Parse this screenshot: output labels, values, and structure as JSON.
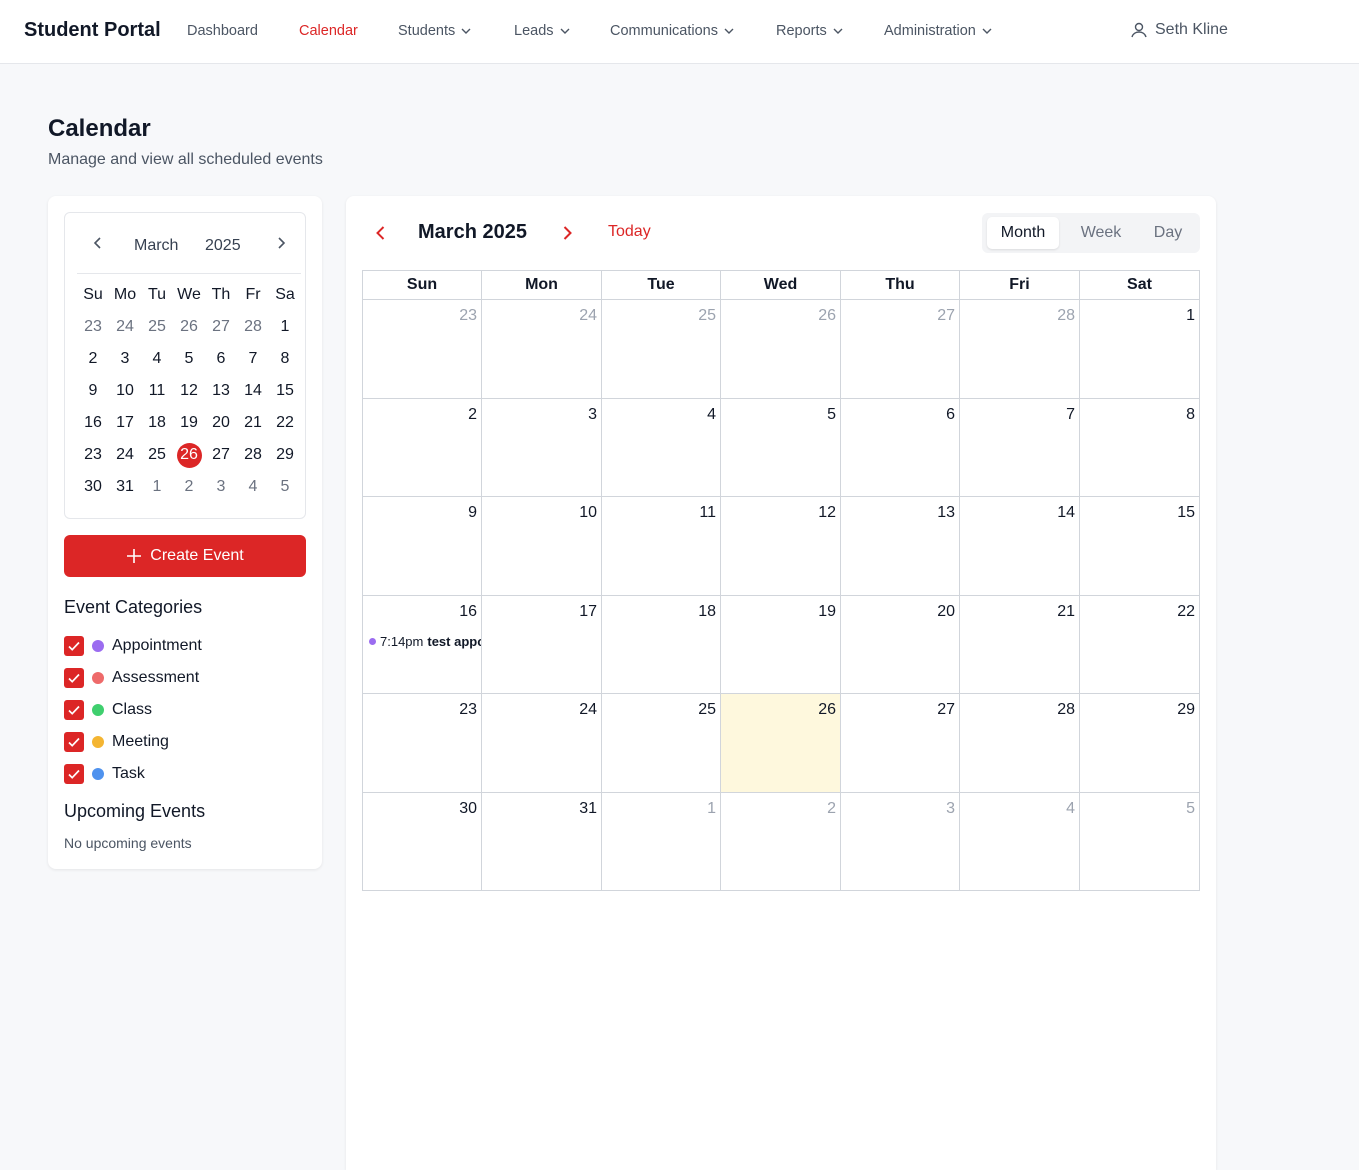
{
  "app": {
    "brand": "Student Portal",
    "nav": [
      "Dashboard",
      "Calendar",
      "Students",
      "Leads",
      "Communications",
      "Reports",
      "Administration"
    ],
    "user": "Seth Kline"
  },
  "page": {
    "title": "Calendar",
    "subtitle": "Manage and view all scheduled events"
  },
  "mini_calendar": {
    "month": "March",
    "year": "2025",
    "weekdays": [
      "Su",
      "Mo",
      "Tu",
      "We",
      "Th",
      "Fr",
      "Sa"
    ],
    "days": [
      "23",
      "24",
      "25",
      "26",
      "27",
      "28",
      "1",
      "2",
      "3",
      "4",
      "5",
      "6",
      "7",
      "8",
      "9",
      "10",
      "11",
      "12",
      "13",
      "14",
      "15",
      "16",
      "17",
      "18",
      "19",
      "20",
      "21",
      "22",
      "23",
      "24",
      "25",
      "26",
      "27",
      "28",
      "29",
      "30",
      "31",
      "1",
      "2",
      "3",
      "4",
      "5"
    ],
    "today": "26"
  },
  "create_event_label": "Create Event",
  "categories_title": "Event Categories",
  "categories": [
    {
      "label": "Appointment",
      "color": "#9b6cf0"
    },
    {
      "label": "Assessment",
      "color": "#ee6a6a"
    },
    {
      "label": "Class",
      "color": "#3fcf6e"
    },
    {
      "label": "Meeting",
      "color": "#f4b532"
    },
    {
      "label": "Task",
      "color": "#4f92ee"
    }
  ],
  "upcoming": {
    "title": "Upcoming Events",
    "empty": "No upcoming events"
  },
  "calendar": {
    "title": "March 2025",
    "today_label": "Today",
    "views": [
      "Month",
      "Week",
      "Day"
    ],
    "active_view": "Month",
    "weekdays": [
      "Sun",
      "Mon",
      "Tue",
      "Wed",
      "Thu",
      "Fri",
      "Sat"
    ],
    "days": [
      "23",
      "24",
      "25",
      "26",
      "27",
      "28",
      "1",
      "2",
      "3",
      "4",
      "5",
      "6",
      "7",
      "8",
      "9",
      "10",
      "11",
      "12",
      "13",
      "14",
      "15",
      "16",
      "17",
      "18",
      "19",
      "20",
      "21",
      "22",
      "23",
      "24",
      "25",
      "26",
      "27",
      "28",
      "29",
      "30",
      "31",
      "1",
      "2",
      "3",
      "4",
      "5"
    ],
    "today": "26",
    "events": [
      {
        "day": "16",
        "time": "7:14pm",
        "title": "test appointment",
        "color": "#9b6cf0"
      }
    ]
  },
  "colors": {
    "accent": "#dc2626",
    "today_bg": "#fef8dd"
  }
}
